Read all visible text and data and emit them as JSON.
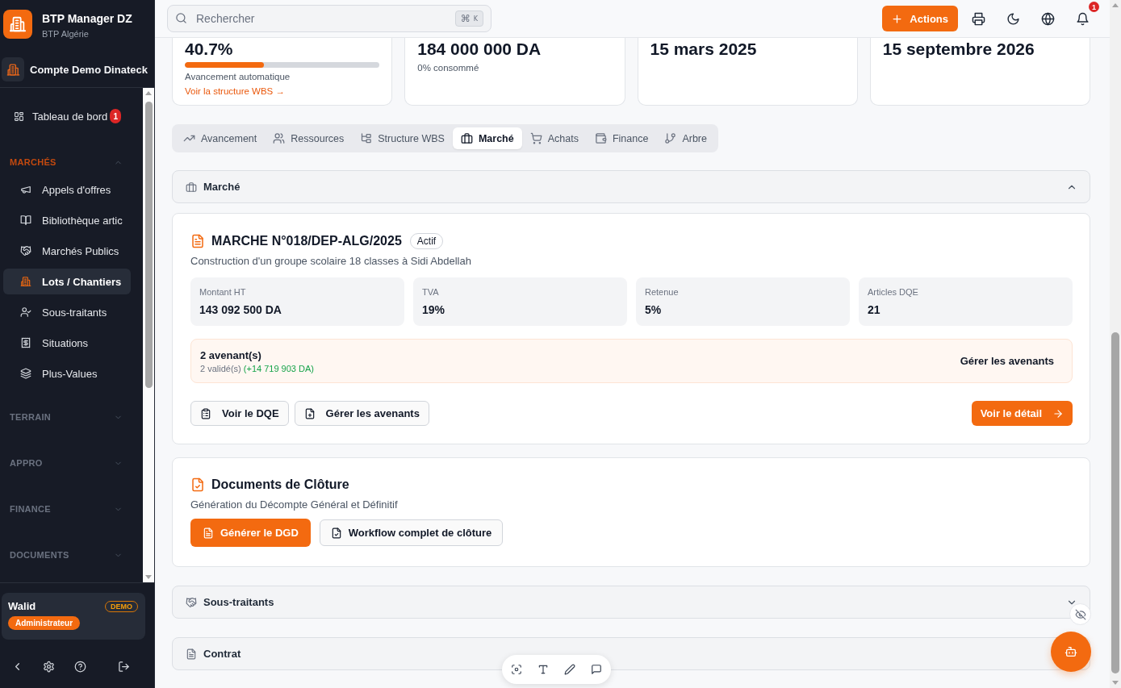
{
  "sidebar": {
    "brand": {
      "name": "BTP Manager DZ",
      "subtitle": "BTP Algérie"
    },
    "account": "Compte Demo Dinateck",
    "nav": [
      {
        "kind": "link",
        "label": "Tableau de bord",
        "badge": "1",
        "selected": false
      },
      {
        "kind": "group",
        "label": "MARCHÉS",
        "expanded": true,
        "children": [
          {
            "label": "Appels d'offres",
            "selected": false
          },
          {
            "label": "Bibliothèque artic",
            "selected": false
          },
          {
            "label": "Marchés Publics",
            "selected": false
          },
          {
            "label": "Lots / Chantiers",
            "selected": true
          },
          {
            "label": "Sous-traitants",
            "selected": false
          },
          {
            "label": "Situations",
            "selected": false
          },
          {
            "label": "Plus-Values",
            "selected": false
          }
        ]
      },
      {
        "kind": "group",
        "label": "TERRAIN",
        "expanded": false
      },
      {
        "kind": "group",
        "label": "APPRO",
        "expanded": false
      },
      {
        "kind": "group",
        "label": "FINANCE",
        "expanded": false
      },
      {
        "kind": "group",
        "label": "DOCUMENTS",
        "expanded": false
      }
    ],
    "user": {
      "name": "Walid",
      "badge": "DEMO",
      "role": "Administrateur"
    }
  },
  "header": {
    "search": {
      "placeholder": "Rechercher",
      "shortcut": [
        "⌘",
        "K"
      ]
    },
    "actions": "Actions",
    "notifications": "1"
  },
  "stats": [
    {
      "value": "40.7%",
      "level": 0.407,
      "caption": "Avancement automatique",
      "link": "Voir la structure WBS →"
    },
    {
      "value": "184 000 000 DA",
      "caption": "0% consommé"
    },
    {
      "value": "15 mars 2025"
    },
    {
      "value": "15 septembre 2026"
    }
  ],
  "tabs": [
    {
      "label": "Avancement",
      "selected": false
    },
    {
      "label": "Ressources",
      "selected": false
    },
    {
      "label": "Structure WBS",
      "selected": false
    },
    {
      "label": "Marché",
      "selected": true
    },
    {
      "label": "Achats",
      "selected": false
    },
    {
      "label": "Finance",
      "selected": false
    },
    {
      "label": "Arbre",
      "selected": false
    }
  ],
  "panels": [
    {
      "title": "Marché",
      "expanded": true,
      "contract": {
        "title": "MARCHE N°018/DEP-ALG/2025",
        "status": "Actif",
        "description": "Construction d'un groupe scolaire 18 classes à Sidi Abdellah",
        "figures": [
          {
            "label": "Montant HT",
            "value": "143 092 500 DA"
          },
          {
            "label": "TVA",
            "value": "19%"
          },
          {
            "label": "Retenue",
            "value": "5%"
          },
          {
            "label": "Articles DQE",
            "value": "21"
          }
        ],
        "amendments": {
          "count": "2 avenant(s)",
          "summary": "2 validé(s)",
          "delta": "(+14 719 903 DA)",
          "action": "Gérer les avenants"
        },
        "buttons": [
          {
            "kind": "outline",
            "label": "Voir le DQE"
          },
          {
            "kind": "outline",
            "label": "Gérer les avenants"
          },
          {
            "kind": "primary",
            "label": "Voir le détail"
          }
        ]
      },
      "closing": {
        "title": "Documents de Clôture",
        "description": "Génération du Décompte Général et Définitif",
        "buttons": [
          {
            "kind": "primary",
            "label": "Générer le DGD"
          },
          {
            "kind": "outline",
            "label": "Workflow complet de clôture"
          }
        ]
      }
    },
    {
      "title": "Sous-traitants",
      "expanded": false
    },
    {
      "title": "Contrat"
    }
  ]
}
